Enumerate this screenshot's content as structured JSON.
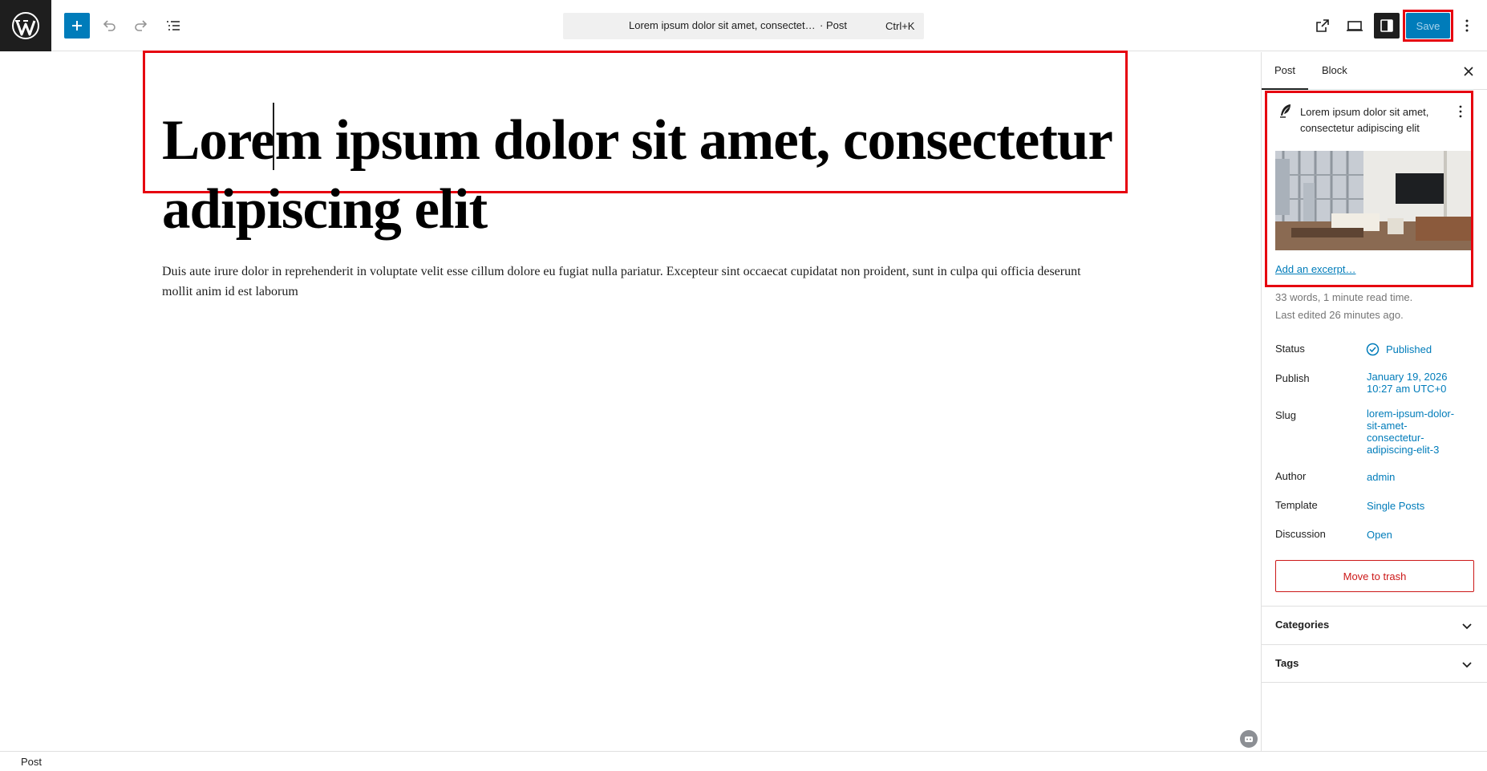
{
  "header": {
    "command_bar": {
      "title": "Lorem ipsum dolor sit amet, consectet…",
      "type": "· Post",
      "shortcut": "Ctrl+K"
    },
    "save_label": "Save"
  },
  "editor": {
    "title": "Lorem ipsum dolor sit amet, consectetur adipiscing elit",
    "body": "Duis aute irure dolor in reprehenderit in voluptate velit esse cillum dolore eu fugiat nulla pariatur. Excepteur sint occaecat cupidatat non proident, sunt in culpa qui officia deserunt mollit anim id est laborum"
  },
  "sidebar": {
    "tabs": [
      "Post",
      "Block"
    ],
    "summary": {
      "title": "Lorem ipsum dolor sit amet, consectetur adipiscing elit",
      "excerpt_link": "Add an excerpt…",
      "words": "33 words, 1 minute read time.",
      "edited": "Last edited 26 minutes ago."
    },
    "rows": {
      "status": {
        "label": "Status",
        "value": "Published"
      },
      "publish": {
        "label": "Publish",
        "value_line1": "January 19, 2026",
        "value_line2": "10:27 am UTC+0"
      },
      "slug": {
        "label": "Slug",
        "lines": [
          "lorem-ipsum-dolor-",
          "sit-amet-",
          "consectetur-",
          "adipiscing-elit-3"
        ]
      },
      "author": {
        "label": "Author",
        "value": "admin"
      },
      "template": {
        "label": "Template",
        "value": "Single Posts"
      },
      "discussion": {
        "label": "Discussion",
        "value": "Open"
      }
    },
    "trash_label": "Move to trash",
    "panels": [
      "Categories",
      "Tags"
    ]
  },
  "statusbar": {
    "breadcrumb": "Post"
  },
  "colors": {
    "accent": "#007cba",
    "highlight": "#e6000f",
    "danger": "#cc1818",
    "dark": "#1e1e1e"
  }
}
